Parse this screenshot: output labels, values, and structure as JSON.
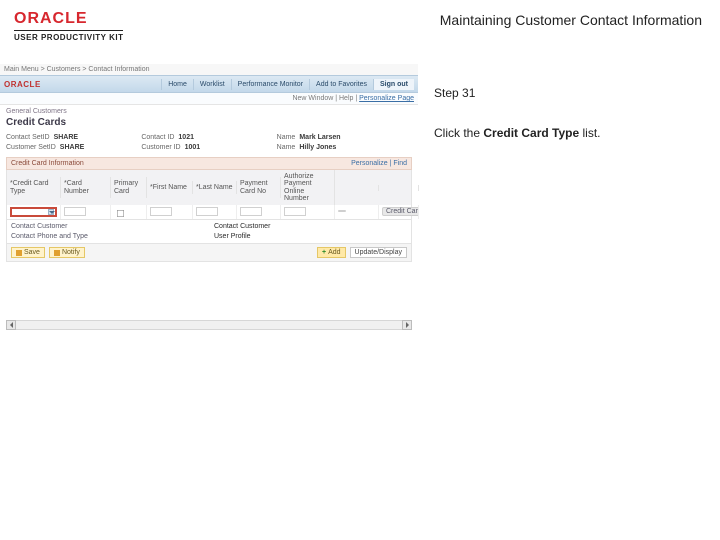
{
  "brand": {
    "logo_text": "ORACLE",
    "subtitle": "USER PRODUCTIVITY KIT"
  },
  "header_title": "Maintaining Customer Contact Information",
  "right_panel": {
    "step_label": "Step 31",
    "instruction_prefix": "Click the ",
    "instruction_bold": "Credit Card Type",
    "instruction_suffix": " list."
  },
  "app": {
    "breadcrumb_top": "Main Menu > Customers > Contact Information",
    "logo_text": "ORACLE",
    "tabs": [
      "Home",
      "Worklist",
      "Performance Monitor",
      "Add to Favorites",
      "Sign out"
    ],
    "active_tab_index": 4,
    "user_line_prefix": "New Window | Help | ",
    "user_line_link": "Personalize Page",
    "breadcrumb2": "General Customers",
    "page_title": "Credit Cards",
    "info": [
      {
        "label": "Contact SetID",
        "value": "SHARE"
      },
      {
        "label": "Contact ID",
        "value": "1021"
      },
      {
        "label": "Name",
        "value": "Mark Larsen"
      },
      {
        "label": "Customer SetID",
        "value": "SHARE"
      },
      {
        "label": "Customer ID",
        "value": "1001"
      },
      {
        "label": "Name",
        "value": "Hilly Jones"
      }
    ],
    "section": {
      "title": "Credit Card Information",
      "links": "Personalize | Find"
    },
    "table": {
      "headers": [
        "*Credit Card Type",
        "*Card Number",
        "Primary Card",
        "*First Name",
        "*Last Name",
        "Payment Card No",
        "Authorize Payment Online Number",
        "",
        ""
      ],
      "row": {
        "dropdown_value": "",
        "card_number": "",
        "primary_checked": false,
        "first_name": "",
        "last_name": "",
        "payment_card_no": "",
        "auth_num": "",
        "pill1": "",
        "pill2": "Credit Card"
      }
    },
    "pairs": [
      {
        "label": "Contact Customer",
        "value": "Contact Customer"
      },
      {
        "label": "Contact Phone and Type",
        "value": "",
        "value2": "User Profile"
      }
    ],
    "footer": {
      "left_buttons": [
        "Save",
        "Notify"
      ],
      "right_buttons": [
        {
          "label": "Add",
          "style": "yellow",
          "icon": "plus"
        },
        {
          "label": "Update/Display",
          "style": "plain"
        }
      ]
    }
  }
}
